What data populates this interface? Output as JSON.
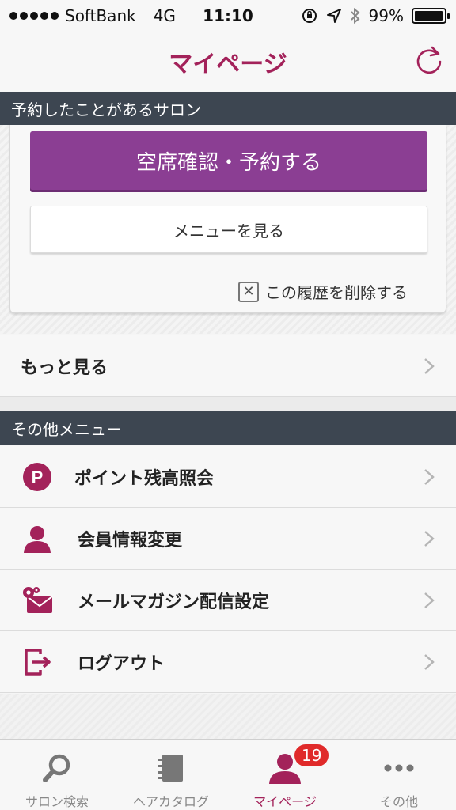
{
  "status_bar": {
    "carrier": "SoftBank",
    "network": "4G",
    "time": "11:10",
    "battery_percent": "99%",
    "battery_level": 0.99
  },
  "nav": {
    "title": "マイページ",
    "refresh_icon": "refresh-icon"
  },
  "salon_section": {
    "header": "予約したことがあるサロン",
    "reserve_button": "空席確認・予約する",
    "menu_button": "メニューを見る",
    "delete_history": "この履歴を削除する"
  },
  "more_row": {
    "label": "もっと見る"
  },
  "other_menu": {
    "header": "その他メニュー",
    "items": [
      {
        "label": "ポイント残高照会",
        "icon": "point-icon"
      },
      {
        "label": "会員情報変更",
        "icon": "person-icon"
      },
      {
        "label": "メールマガジン配信設定",
        "icon": "mail-settings-icon"
      },
      {
        "label": "ログアウト",
        "icon": "logout-icon"
      }
    ]
  },
  "tab_bar": {
    "tabs": [
      {
        "label": "サロン検索",
        "icon": "search-icon"
      },
      {
        "label": "ヘアカタログ",
        "icon": "catalog-icon"
      },
      {
        "label": "マイページ",
        "icon": "person-icon",
        "active": true
      },
      {
        "label": "その他",
        "icon": "more-icon"
      }
    ],
    "badge": "19"
  },
  "colors": {
    "accent": "#a3225a",
    "reserve_button": "#8b3e93",
    "section_header": "#3d4651",
    "badge": "#e02a2a"
  }
}
